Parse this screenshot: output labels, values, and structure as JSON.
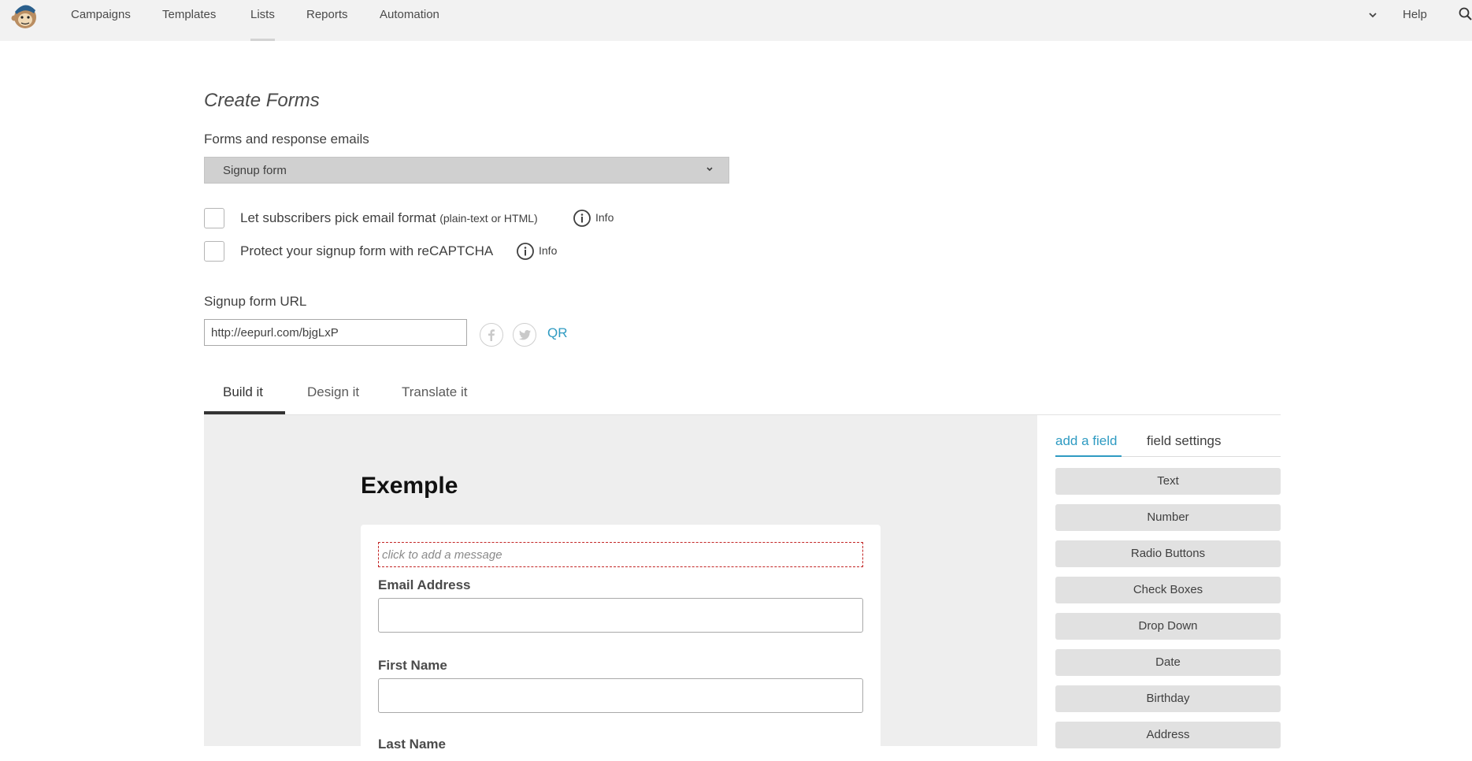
{
  "nav": {
    "items": [
      "Campaigns",
      "Templates",
      "Lists",
      "Reports",
      "Automation"
    ],
    "active": "Lists",
    "help_label": "Help"
  },
  "page": {
    "title": "Create Forms",
    "forms_label": "Forms and response emails",
    "form_type_selected": "Signup form"
  },
  "options": {
    "email_format_label": "Let subscribers pick email format",
    "email_format_note": "(plain-text or HTML)",
    "recaptcha_label": "Protect your signup form with reCAPTCHA",
    "info_label": "Info"
  },
  "signup_url": {
    "label": "Signup form URL",
    "value": "http://eepurl.com/bjgLxP",
    "qr_label": "QR"
  },
  "tabs": [
    "Build it",
    "Design it",
    "Translate it"
  ],
  "builder": {
    "form_title": "Exemple",
    "message_placeholder": "click to add a message",
    "fields": [
      "Email Address",
      "First Name",
      "Last Name"
    ]
  },
  "right_panel": {
    "tab_add": "add a field",
    "tab_settings": "field settings",
    "field_types": [
      "Text",
      "Number",
      "Radio Buttons",
      "Check Boxes",
      "Drop Down",
      "Date",
      "Birthday",
      "Address"
    ]
  },
  "colors": {
    "accent": "#2f9bc2",
    "nav_bg": "#f2f2f2",
    "builder_bg": "#eeeeee",
    "message_border": "#c32525"
  }
}
